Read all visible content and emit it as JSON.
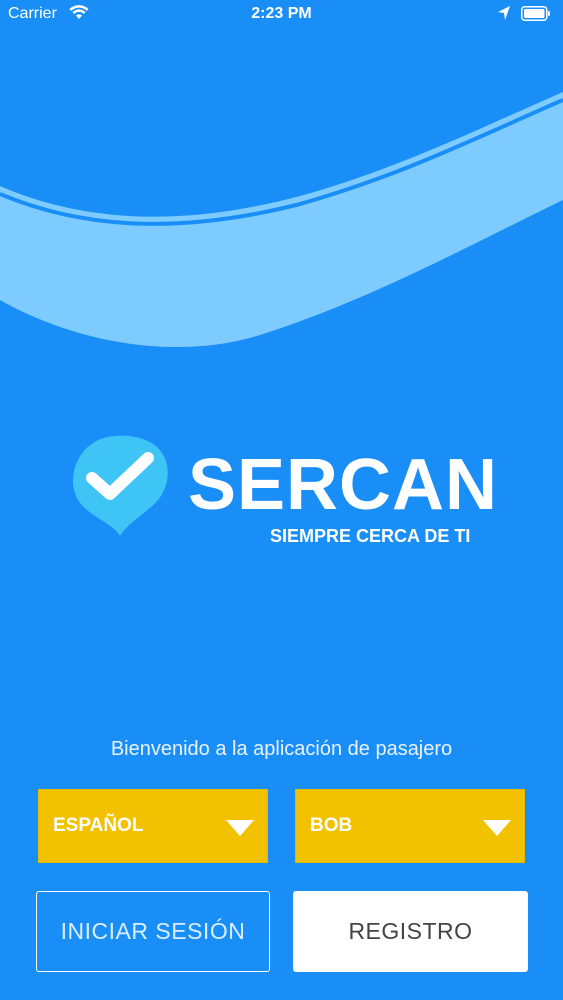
{
  "status_bar": {
    "carrier": "Carrier",
    "time": "2:23 PM",
    "icons": [
      "wifi-icon",
      "location-arrow-icon",
      "battery-icon"
    ]
  },
  "brand": {
    "name": "SERCAN",
    "tagline": "SIEMPRE CERCA DE TI",
    "icon": "check-pin-icon"
  },
  "welcome": "Bienvenido a la aplicación de pasajero",
  "selectors": {
    "language": "ESPAÑOL",
    "city": "BOB"
  },
  "buttons": {
    "login": "INICIAR SESIÓN",
    "register": "REGISTRO"
  },
  "colors": {
    "background": "#1a8ef7",
    "wave": "#7ecbff",
    "dropdown": "#f2c200",
    "pin": "#3ec4f5"
  }
}
